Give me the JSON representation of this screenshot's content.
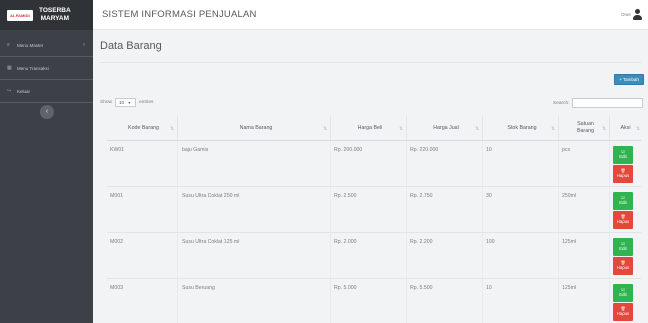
{
  "sidebar": {
    "logo_text": "ALFAMIDI",
    "brand_line1": "TOSERBA",
    "brand_line2": "MARYAM",
    "items": [
      {
        "label": "Menu Master",
        "icon": "list-icon",
        "chevron": "›"
      },
      {
        "label": "Menu Transaksi",
        "icon": "grid-icon"
      },
      {
        "label": "Keluar",
        "icon": "logout-icon"
      }
    ],
    "collapse_glyph": "‹"
  },
  "header": {
    "title": "SISTEM INFORMASI PENJUALAN",
    "user_name": "Oner"
  },
  "page": {
    "title": "Data Barang",
    "add_button": "+ Tambah",
    "show_label": "Show",
    "entries_value": "10",
    "entries_label": "entries",
    "search_label": "Search:"
  },
  "table": {
    "headers": [
      "Kode Barang",
      "Nama Barang",
      "Harga Beli",
      "Harga Jual",
      "Stok Barang",
      "Satuan Barang",
      "Aksi"
    ],
    "edit_label": "Edit",
    "delete_label": "Hapus",
    "rows": [
      {
        "kode": "KW01",
        "nama": "baju Gamis",
        "beli": "Rp. 200.000",
        "jual": "Rp. 220.000",
        "stok": "10",
        "satuan": "pcs"
      },
      {
        "kode": "M001",
        "nama": "Susu Ultra Coklat 250 ml",
        "beli": "Rp. 2.500",
        "jual": "Rp. 2.750",
        "stok": "30",
        "satuan": "250ml"
      },
      {
        "kode": "M002",
        "nama": "Susu Ultra Coklat 125 ml",
        "beli": "Rp. 2.000",
        "jual": "Rp. 2.200",
        "stok": "100",
        "satuan": "125ml"
      },
      {
        "kode": "M003",
        "nama": "Susu Beruang",
        "beli": "Rp. 5.000",
        "jual": "Rp. 5.500",
        "stok": "10",
        "satuan": "125ml"
      }
    ]
  },
  "colors": {
    "sidebar": "#3d4147",
    "primary": "#3c8dbc",
    "success": "#2fb44f",
    "danger": "#e4473b"
  }
}
